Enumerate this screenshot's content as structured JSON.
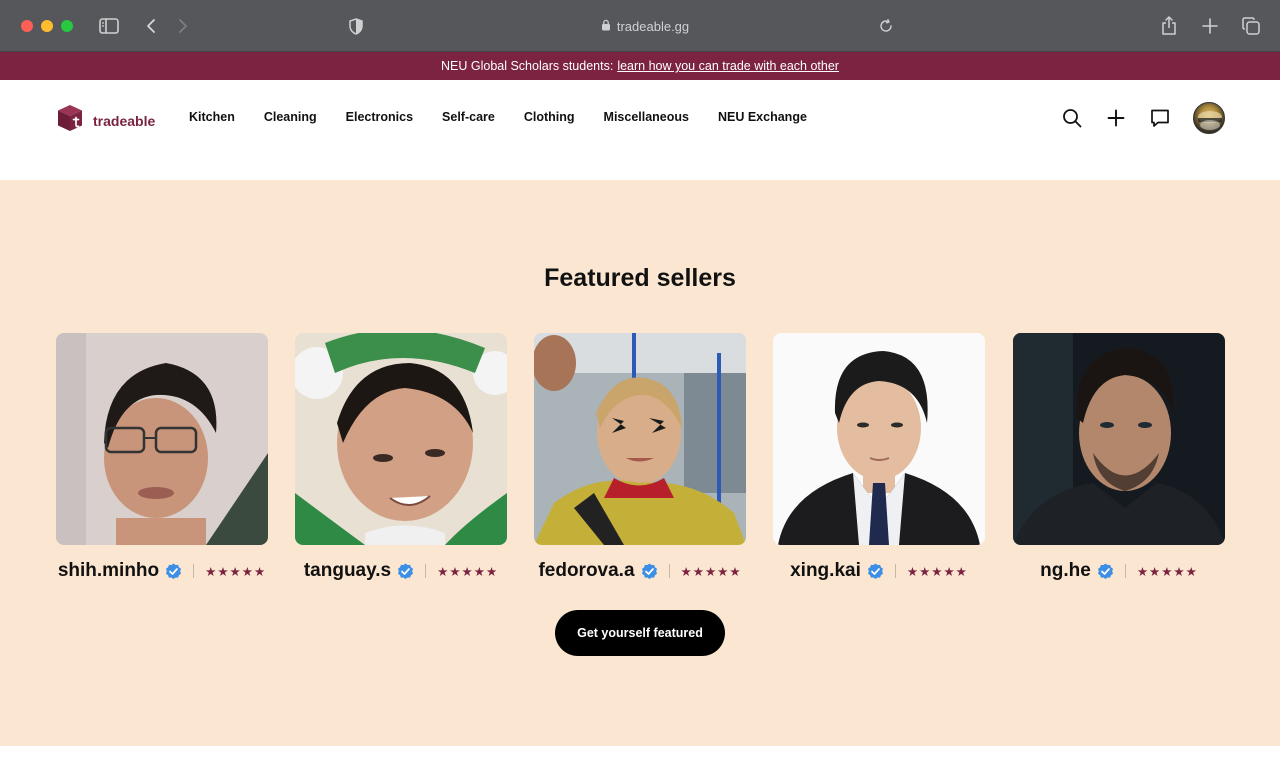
{
  "browser": {
    "url": "tradeable.gg"
  },
  "announcement": {
    "prefix": "NEU Global Scholars students:",
    "link_text": "learn how you can trade with each other"
  },
  "nav": {
    "logo_text": "tradeable",
    "links": [
      "Kitchen",
      "Cleaning",
      "Electronics",
      "Self-care",
      "Clothing",
      "Miscellaneous",
      "NEU Exchange"
    ]
  },
  "featured": {
    "title": "Featured sellers",
    "sellers": [
      {
        "name": "shih.minho",
        "rating": 5,
        "stars": "★★★★★"
      },
      {
        "name": "tanguay.s",
        "rating": 5,
        "stars": "★★★★★"
      },
      {
        "name": "fedorova.a",
        "rating": 5,
        "stars": "★★★★★"
      },
      {
        "name": "xing.kai",
        "rating": 5,
        "stars": "★★★★★"
      },
      {
        "name": "ng.he",
        "rating": 5,
        "stars": "★★★★★"
      }
    ],
    "cta_label": "Get yourself featured"
  },
  "colors": {
    "brand": "#7b2341",
    "section_bg": "#fbe7d1",
    "verified_blue": "#3d8fe6"
  },
  "icons": [
    "sidebar-icon",
    "back-icon",
    "forward-icon",
    "shield-icon",
    "lock-icon",
    "reload-icon",
    "share-icon",
    "new-tab-icon",
    "tabs-icon",
    "search-icon",
    "plus-icon",
    "chat-icon",
    "verified-icon"
  ]
}
